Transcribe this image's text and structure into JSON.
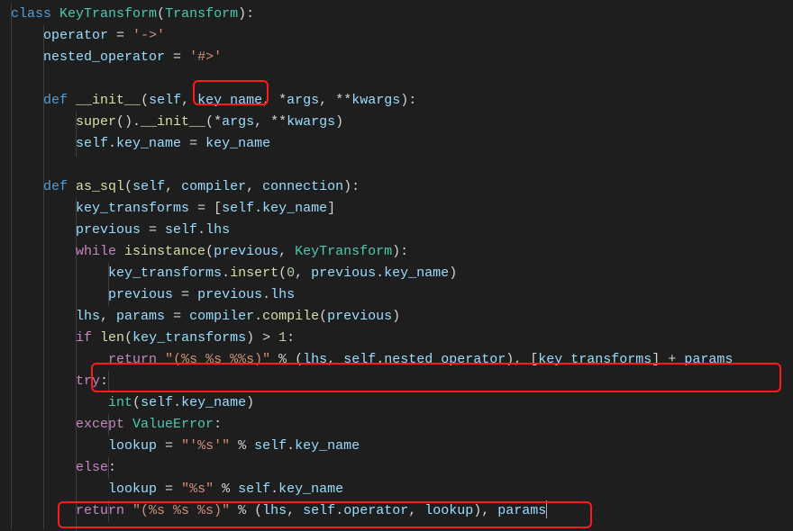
{
  "code": {
    "class_kw": "class",
    "class_name": "KeyTransform",
    "base_class": "Transform",
    "colon": ":",
    "operator_attr": "operator",
    "eq": " = ",
    "operator_val": "'->'",
    "nested_attr": "nested_operator",
    "nested_val": "'#>'",
    "def_kw": "def",
    "init_name": "__init__",
    "self_kw": "self",
    "key_name_param": "key_name",
    "star_args": "*",
    "args": "args",
    "dstar": "**",
    "kwargs": "kwargs",
    "super_fn": "super",
    "init_call": "__init__",
    "assign_self": "self",
    "as_sql_name": "as_sql",
    "compiler": "compiler",
    "connection": "connection",
    "key_transforms": "key_transforms",
    "previous": "previous",
    "lhs": "lhs",
    "while_kw": "while",
    "isinstance_fn": "isinstance",
    "keytransform_type": "KeyTransform",
    "insert_fn": "insert",
    "zero": "0",
    "params": "params",
    "compile_fn": "compile",
    "if_kw": "if",
    "len_fn": "len",
    "gt": ">",
    "one": "1",
    "return_kw": "return",
    "fmt_triple": "\"(%s %s %%s)\"",
    "pct": "%",
    "plus": "+",
    "try_kw": "try",
    "int_fn": "int",
    "except_kw": "except",
    "valueerror": "ValueError",
    "lookup": "lookup",
    "fmt_quoted": "\"'%s'\"",
    "else_kw": "else",
    "fmt_plain": "\"%s\"",
    "fmt_final": "\"(%s %s %s)\""
  },
  "highlight_semantics": {
    "hl1": "parameter key_name in __init__ signature",
    "hl2": "return statement for nested_operator branch",
    "hl3": "final return statement with operator and lookup"
  }
}
